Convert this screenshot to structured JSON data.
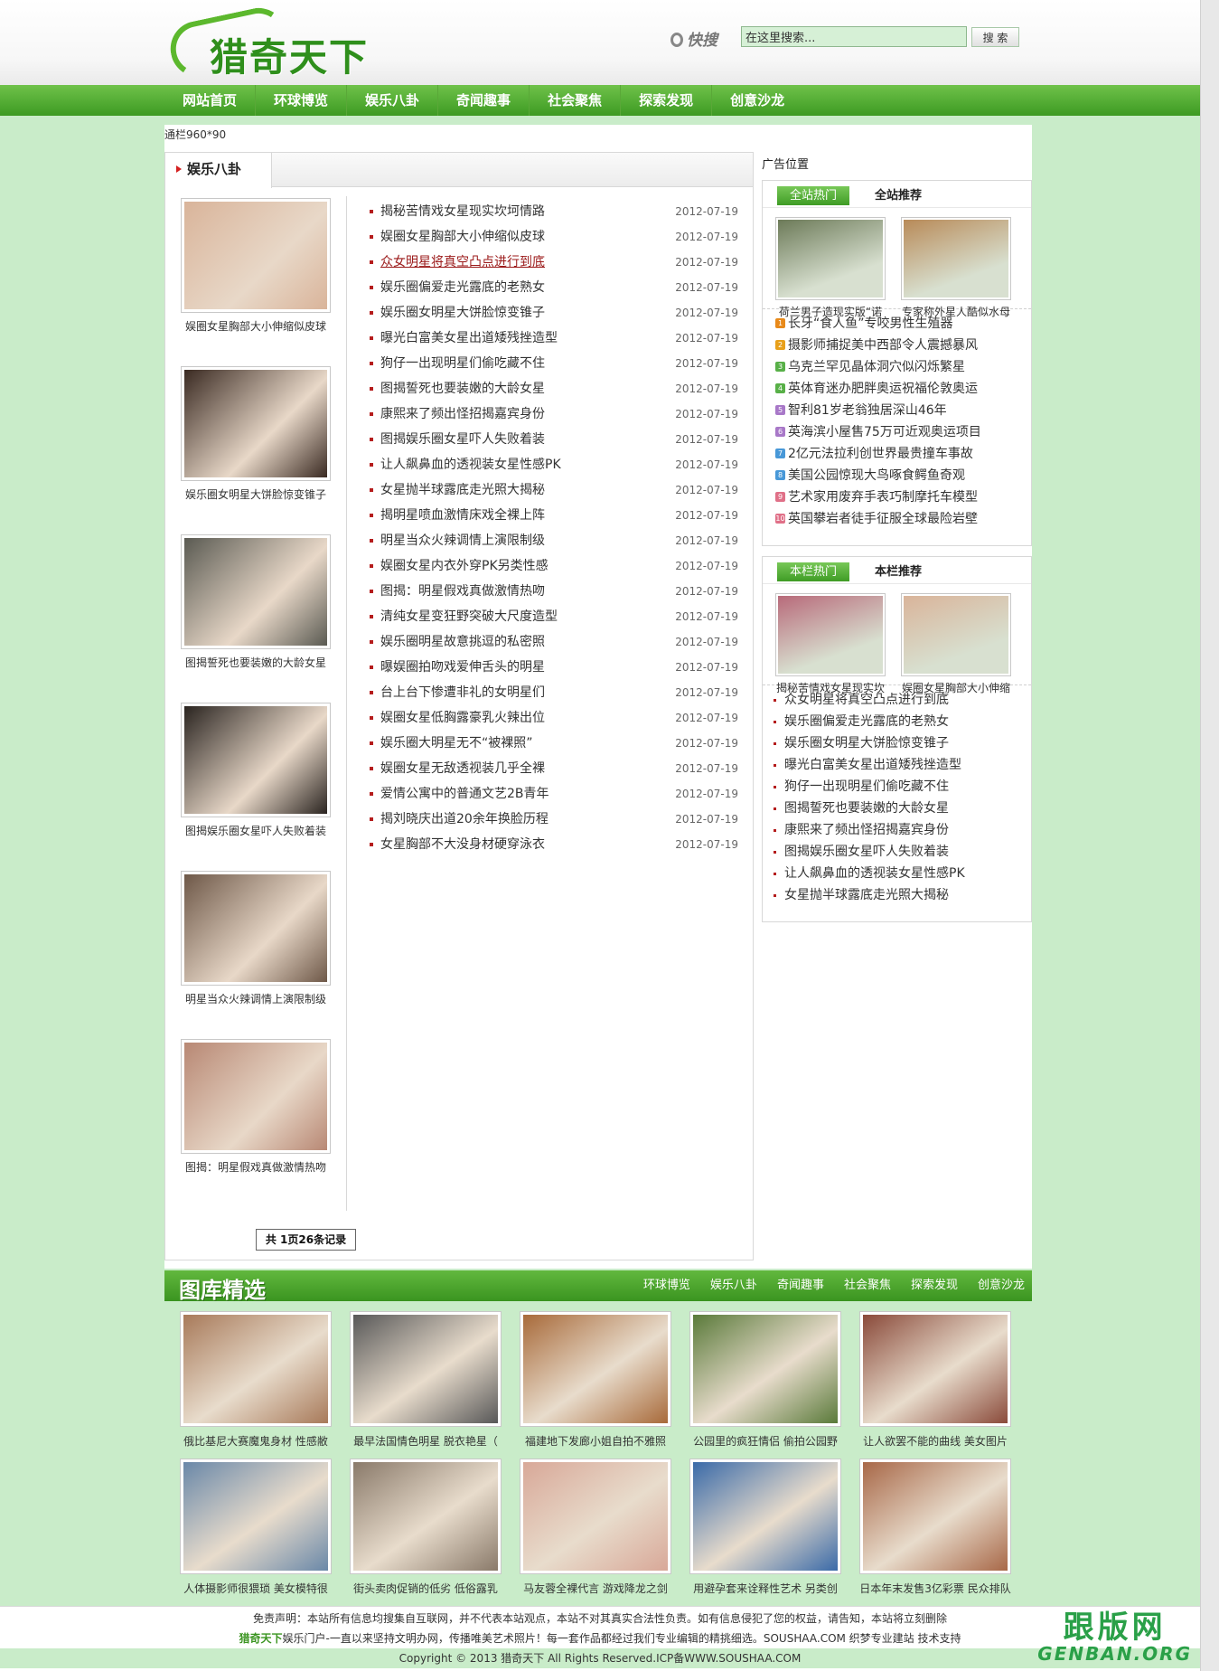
{
  "site": {
    "logo_text": "猎奇天下"
  },
  "search": {
    "label": "快搜",
    "placeholder": "在这里搜索...",
    "value": "在这里搜索...",
    "button": "搜 索"
  },
  "nav": [
    "网站首页",
    "环球博览",
    "娱乐八卦",
    "奇闻趣事",
    "社会聚焦",
    "探索发现",
    "创意沙龙"
  ],
  "banner_text": "通栏960*90",
  "left": {
    "tab": "娱乐八卦",
    "thumbs": [
      {
        "caption": "娱圈女星胸部大小伸缩似皮球",
        "color": "#d9b49a"
      },
      {
        "caption": "娱乐圈女明星大饼脸惊变锥子",
        "color": "#3a2a22"
      },
      {
        "caption": "图揭誓死也要装嫩的大龄女星",
        "color": "#5a5a52"
      },
      {
        "caption": "图揭娱乐圈女星吓人失败着装",
        "color": "#2a2420"
      },
      {
        "caption": "明星当众火辣调情上演限制级",
        "color": "#6e5848"
      },
      {
        "caption": "图揭：明星假戏真做激情热吻",
        "color": "#b88874"
      }
    ],
    "news": [
      {
        "title": "揭秘苦情戏女星现实坎坷情路",
        "date": "2012-07-19"
      },
      {
        "title": "娱圈女星胸部大小伸缩似皮球",
        "date": "2012-07-19"
      },
      {
        "title": "众女明星将真空凸点进行到底",
        "date": "2012-07-19"
      },
      {
        "title": "娱乐圈偏爱走光露底的老熟女",
        "date": "2012-07-19"
      },
      {
        "title": "娱乐圈女明星大饼脸惊变锥子",
        "date": "2012-07-19"
      },
      {
        "title": "曝光白富美女星出道矮残挫造型",
        "date": "2012-07-19"
      },
      {
        "title": "狗仔一出现明星们偷吃藏不住",
        "date": "2012-07-19"
      },
      {
        "title": "图揭誓死也要装嫩的大龄女星",
        "date": "2012-07-19"
      },
      {
        "title": "康熙来了频出怪招揭嘉宾身份",
        "date": "2012-07-19"
      },
      {
        "title": "图揭娱乐圈女星吓人失败着装",
        "date": "2012-07-19"
      },
      {
        "title": "让人飙鼻血的透视装女星性感PK",
        "date": "2012-07-19"
      },
      {
        "title": "女星抛半球露底走光照大揭秘",
        "date": "2012-07-19"
      },
      {
        "title": "揭明星喷血激情床戏全裸上阵",
        "date": "2012-07-19"
      },
      {
        "title": "明星当众火辣调情上演限制级",
        "date": "2012-07-19"
      },
      {
        "title": "娱圈女星内衣外穿PK另类性感",
        "date": "2012-07-19"
      },
      {
        "title": "图揭：明星假戏真做激情热吻",
        "date": "2012-07-19"
      },
      {
        "title": "清纯女星变狂野突破大尺度造型",
        "date": "2012-07-19"
      },
      {
        "title": "娱乐圈明星故意挑逗的私密照",
        "date": "2012-07-19"
      },
      {
        "title": "曝娱圈拍吻戏爱伸舌头的明星",
        "date": "2012-07-19"
      },
      {
        "title": "台上台下惨遭非礼的女明星们",
        "date": "2012-07-19"
      },
      {
        "title": "娱圈女星低胸露豪乳火辣出位",
        "date": "2012-07-19"
      },
      {
        "title": "娱乐圈大明星无不“被裸照”",
        "date": "2012-07-19"
      },
      {
        "title": "娱圈女星无敌透视装几乎全裸",
        "date": "2012-07-19"
      },
      {
        "title": "爱情公寓中的普通文艺2B青年",
        "date": "2012-07-19"
      },
      {
        "title": "揭刘晓庆出道20余年换脸历程",
        "date": "2012-07-19"
      },
      {
        "title": "女星胸部不大没身材硬穿泳衣",
        "date": "2012-07-19"
      }
    ],
    "pager": "共 1页26条记录"
  },
  "right": {
    "ad_label": "广告位置",
    "box1": {
      "tab_on": "全站热门",
      "tab_off": "全站推荐",
      "pics": [
        {
          "caption": "荷兰男子造现实版“诺",
          "color": "#6c7a58"
        },
        {
          "caption": "专家称外星人酷似水母",
          "color": "#b88a58"
        }
      ],
      "items": [
        {
          "n": "1",
          "c": "#e88a1a",
          "t": "长牙“食人鱼”专咬男性生殖器"
        },
        {
          "n": "2",
          "c": "#e8a01a",
          "t": "摄影师捕捉美中西部令人震撼暴风"
        },
        {
          "n": "3",
          "c": "#58b048",
          "t": "乌克兰罕见晶体洞穴似闪烁繁星"
        },
        {
          "n": "4",
          "c": "#58b048",
          "t": "英体育迷办肥胖奥运祝福伦敦奥运"
        },
        {
          "n": "5",
          "c": "#a878c8",
          "t": "智利81岁老翁独居深山46年"
        },
        {
          "n": "6",
          "c": "#a878c8",
          "t": "英海滨小屋售75万可近观奥运项目"
        },
        {
          "n": "7",
          "c": "#4898d8",
          "t": "2亿元法拉利创世界最贵撞车事故"
        },
        {
          "n": "8",
          "c": "#4898d8",
          "t": "美国公园惊现大鸟啄食鳄鱼奇观"
        },
        {
          "n": "9",
          "c": "#e07088",
          "t": "艺术家用废弃手表巧制摩托车模型"
        },
        {
          "n": "10",
          "c": "#e07088",
          "t": "英国攀岩者徒手征服全球最险岩壁"
        }
      ]
    },
    "box2": {
      "tab_on": "本栏热门",
      "tab_off": "本栏推荐",
      "pics": [
        {
          "caption": "揭秘苦情戏女星现实坎",
          "color": "#b86a7a"
        },
        {
          "caption": "娱圈女星胸部大小伸缩",
          "color": "#d9b49a"
        }
      ],
      "items": [
        "众女明星将真空凸点进行到底",
        "娱乐圈偏爱走光露底的老熟女",
        "娱乐圈女明星大饼脸惊变锥子",
        "曝光白富美女星出道矮残挫造型",
        "狗仔一出现明星们偷吃藏不住",
        "图揭誓死也要装嫩的大龄女星",
        "康熙来了频出怪招揭嘉宾身份",
        "图揭娱乐圈女星吓人失败着装",
        "让人飙鼻血的透视装女星性感PK",
        "女星抛半球露底走光照大揭秘"
      ]
    }
  },
  "gallery": {
    "title": "图库精选",
    "links": [
      "环球博览",
      "娱乐八卦",
      "奇闻趣事",
      "社会聚焦",
      "探索发现",
      "创意沙龙"
    ],
    "items": [
      {
        "caption": "俄比基尼大赛魔鬼身材 性感敝",
        "color": "#a87a5a"
      },
      {
        "caption": "最早法国情色明星 脱衣艳星（",
        "color": "#585858"
      },
      {
        "caption": "福建地下发廊小姐自拍不雅照",
        "color": "#a86a3a"
      },
      {
        "caption": "公园里的疯狂情侣 偷拍公园野",
        "color": "#5a7a3a"
      },
      {
        "caption": "让人欲罢不能的曲线 美女图片",
        "color": "#8a4a3a"
      },
      {
        "caption": "人体摄影师很猥琐 美女模特很",
        "color": "#6a88a8"
      },
      {
        "caption": "街头卖肉促销的低劣 低俗露乳",
        "color": "#8a7a6a"
      },
      {
        "caption": "马友蓉全裸代言 游戏降龙之剑",
        "color": "#d8a898"
      },
      {
        "caption": "用避孕套来诠释性艺术 另类创",
        "color": "#3a6aa8"
      },
      {
        "caption": "日本年末发售3亿彩票 民众排队",
        "color": "#a86848"
      }
    ]
  },
  "footer": {
    "line1": "免责声明：本站所有信息均搜集自互联网，并不代表本站观点，本站不对其真实合法性负责。如有信息侵犯了您的权益，请告知，本站将立刻删除",
    "brand": "猎奇天下",
    "line2": "娱乐门户-一直以来坚持文明办网，传播唯美艺术照片！每一套作品都经过我们专业编辑的精挑细选。SOUSHAA.COM 织梦专业建站 技术支持",
    "line3": "Copyright © 2013 猎奇天下  All Rights Reserved.ICP备WWW.SOUSHAA.COM"
  },
  "watermark": {
    "line1": "跟版网",
    "line2": "GENBAN.ORG"
  }
}
